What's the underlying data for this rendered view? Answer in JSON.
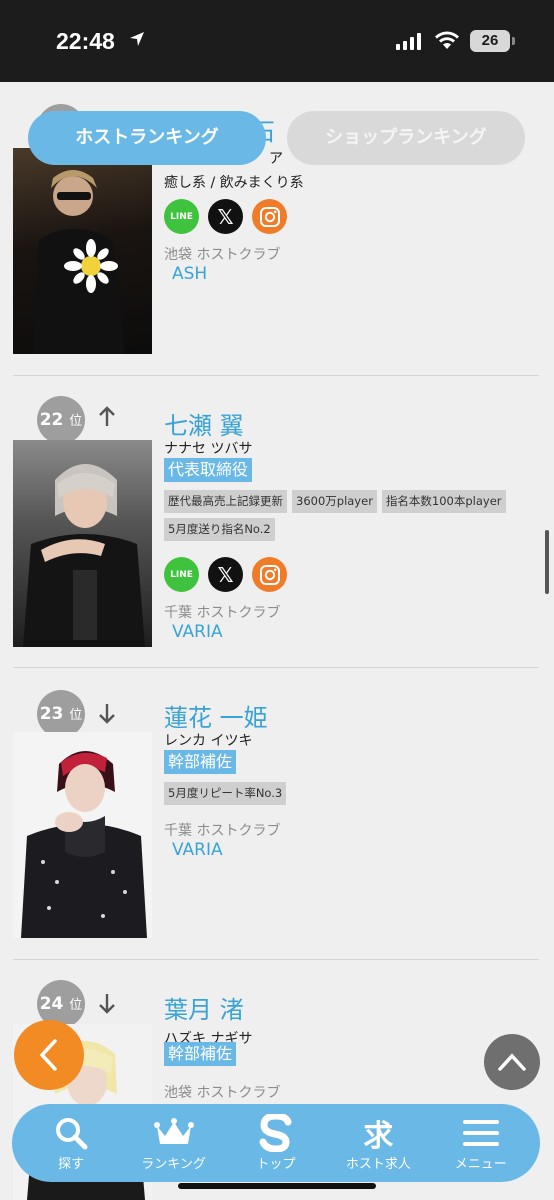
{
  "status_bar": {
    "time": "22:48",
    "battery": "26"
  },
  "tabs": {
    "host_ranking": "ホストランキング",
    "shop_ranking": "ショップランキング"
  },
  "cards": [
    {
      "name_partial": "石",
      "kana_partial": "ア",
      "tagline": "癒し系 / 飲みまくり系",
      "area": "池袋 ホストクラブ",
      "club": "ASH"
    },
    {
      "rank": "22",
      "rank_suffix": "位",
      "trend": "up",
      "name": "七瀬 翼",
      "kana": "ナナセ ツバサ",
      "role": "代表取締役",
      "tags": [
        "歴代最高売上記録更新",
        "3600万player",
        "指名本数100本player",
        "5月度送り指名No.2"
      ],
      "area": "千葉 ホストクラブ",
      "club": "VARIA"
    },
    {
      "rank": "23",
      "rank_suffix": "位",
      "trend": "down",
      "name": "蓮花 一姫",
      "kana": "レンカ イツキ",
      "role": "幹部補佐",
      "tags": [
        "5月度リピート率No.3"
      ],
      "area": "千葉 ホストクラブ",
      "club": "VARIA"
    },
    {
      "rank": "24",
      "rank_suffix": "位",
      "trend": "down",
      "name": "葉月 渚",
      "kana": "ハズキ ナギサ",
      "role": "幹部補佐",
      "area": "池袋 ホストクラブ"
    }
  ],
  "social_labels": {
    "line": "LINE",
    "x": "𝕏"
  },
  "bottom_nav": [
    {
      "label": "探す",
      "icon": "search-icon"
    },
    {
      "label": "ランキング",
      "icon": "crown-icon"
    },
    {
      "label": "トップ",
      "icon": "s-logo-icon"
    },
    {
      "label": "ホスト求人",
      "icon": "kyu-icon",
      "glyph": "求"
    },
    {
      "label": "メニュー",
      "icon": "menu-icon"
    }
  ],
  "colors": {
    "accent": "#6ab8e6",
    "link": "#3aa3d6",
    "back_button": "#f28b23",
    "line": "#3fc23d",
    "instagram": "#f07b28"
  }
}
